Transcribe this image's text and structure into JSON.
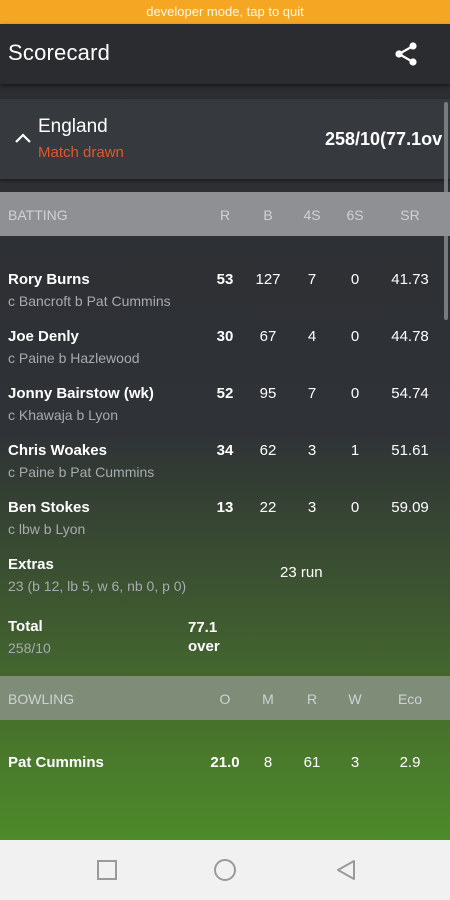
{
  "dev_banner": "developer mode, tap to quit",
  "app_bar": {
    "title": "Scorecard",
    "share_icon": "share-icon"
  },
  "team": {
    "name": "England",
    "result": "Match drawn",
    "score": "258/10(77.1ov",
    "result_color": "#e2572c"
  },
  "batting": {
    "headers": {
      "label": "BATTING",
      "r": "R",
      "b": "B",
      "fours": "4S",
      "sixes": "6S",
      "sr": "SR"
    },
    "rows": [
      {
        "name": "Rory Burns",
        "dismissal": "c Bancroft b Pat Cummins",
        "r": "53",
        "b": "127",
        "fours": "7",
        "sixes": "0",
        "sr": "41.73"
      },
      {
        "name": "Joe Denly",
        "dismissal": "c Paine b Hazlewood",
        "r": "30",
        "b": "67",
        "fours": "4",
        "sixes": "0",
        "sr": "44.78"
      },
      {
        "name": "Jonny Bairstow (wk)",
        "dismissal": "c Khawaja b Lyon",
        "r": "52",
        "b": "95",
        "fours": "7",
        "sixes": "0",
        "sr": "54.74"
      },
      {
        "name": "Chris Woakes",
        "dismissal": "c Paine b Pat Cummins",
        "r": "34",
        "b": "62",
        "fours": "3",
        "sixes": "1",
        "sr": "51.61"
      },
      {
        "name": "Ben Stokes",
        "dismissal": "c lbw b Lyon",
        "r": "13",
        "b": "22",
        "fours": "3",
        "sixes": "0",
        "sr": "59.09"
      }
    ],
    "extras": {
      "label": "Extras",
      "detail": "23  (b 12, lb 5, w 6, nb 0, p 0)",
      "value": "23 run"
    },
    "total": {
      "label": "Total",
      "detail": "258/10",
      "overs": "77.1",
      "overs_unit": "over"
    }
  },
  "bowling": {
    "headers": {
      "label": "BOWLING",
      "o": "O",
      "m": "M",
      "r": "R",
      "w": "W",
      "eco": "Eco"
    },
    "rows": [
      {
        "name": "Pat Cummins",
        "o": "21.0",
        "m": "8",
        "r": "61",
        "w": "3",
        "eco": "2.9"
      }
    ]
  },
  "nav": {
    "recents": "recents-icon",
    "home": "home-icon",
    "back": "back-icon"
  }
}
